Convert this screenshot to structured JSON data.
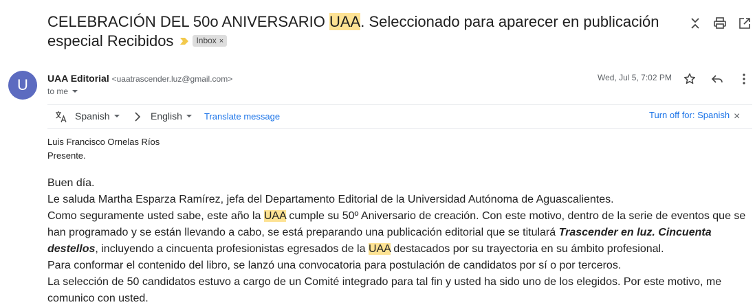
{
  "subject": {
    "part1": "CELEBRACIÓN DEL 50o ANIVERSARIO ",
    "highlight": "UAA",
    "part2": ". Seleccionado para aparecer en publicación especial Recibidos",
    "label": "Inbox",
    "label_close": "×"
  },
  "sender": {
    "avatar_letter": "U",
    "name": "UAA Editorial",
    "email": "<uaatrascender.luz@gmail.com>",
    "to": "to me",
    "date": "Wed, Jul 5, 7:02 PM"
  },
  "translate": {
    "from_lang": "Spanish",
    "to_lang": "English",
    "translate_label": "Translate message",
    "turn_off_label": "Turn off for: Spanish",
    "close": "×"
  },
  "greeting": {
    "line1": "Luis Francisco Ornelas Ríos",
    "line2": "Presente."
  },
  "body": {
    "p1": "Buen día.",
    "p2": "Le saluda Martha Esparza Ramírez, jefa del Departamento Editorial de la Universidad Autónoma de Aguascalientes.",
    "p3a": "Como seguramente usted sabe, este año la ",
    "p3hl": "UAA",
    "p3b": " cumple su 50º Aniversario de creación. Con este motivo, dentro de la serie de eventos que se han programado y se están llevando a cabo, se está preparando una publicación editorial que se titulará ",
    "p3bi": "Trascender en luz. Cincuenta destellos",
    "p3c": ", incluyendo a cincuenta profesionistas egresados de la ",
    "p3hl2": "UAA",
    "p3d": " destacados por su trayectoria en su ámbito profesional.",
    "p4": "Para conformar el contenido del libro, se lanzó una convocatoria para postulación de candidatos por sí o por terceros.",
    "p5": "La selección de 50 candidatos estuvo a cargo de un Comité integrado para tal fin y usted ha sido uno de los elegidos. Por este motivo, me comunico con usted."
  }
}
